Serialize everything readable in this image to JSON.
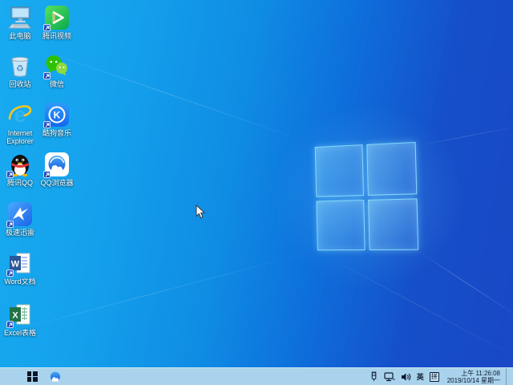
{
  "desktop": {
    "icons": [
      {
        "id": "this-pc",
        "label": "此电脑",
        "shortcut": false
      },
      {
        "id": "tencent-video",
        "label": "腾讯视频",
        "shortcut": true
      },
      {
        "id": "recycle-bin",
        "label": "回收站",
        "shortcut": false
      },
      {
        "id": "wechat",
        "label": "微信",
        "shortcut": true
      },
      {
        "id": "internet-explorer",
        "label": "Internet Explorer",
        "shortcut": false,
        "glyph": "e"
      },
      {
        "id": "kugou-music",
        "label": "酷狗音乐",
        "shortcut": true,
        "glyph": "K"
      },
      {
        "id": "tencent-qq",
        "label": "腾讯QQ",
        "shortcut": true
      },
      {
        "id": "qq-browser",
        "label": "QQ浏览器",
        "shortcut": true
      },
      {
        "id": "thunder",
        "label": "极速迅雷",
        "shortcut": true
      },
      {
        "id": "word-doc",
        "label": "Word文档",
        "shortcut": true,
        "glyph": "W"
      },
      {
        "id": "excel-sheet",
        "label": "Excel表格",
        "shortcut": true,
        "glyph": "X"
      }
    ],
    "recycle_glyph": "♻"
  },
  "taskbar": {
    "tray": {
      "language_indicator": "英",
      "ime_mode": "拼",
      "clock_time": "上午 11:26:08",
      "clock_date": "2019/10/14 星期一"
    }
  },
  "colors": {
    "wallpaper_left": "#18abf0",
    "wallpaper_right": "#1a47c5",
    "taskbar": "#a9d3ec",
    "accent_logo_edge": "#9ae6ff"
  }
}
